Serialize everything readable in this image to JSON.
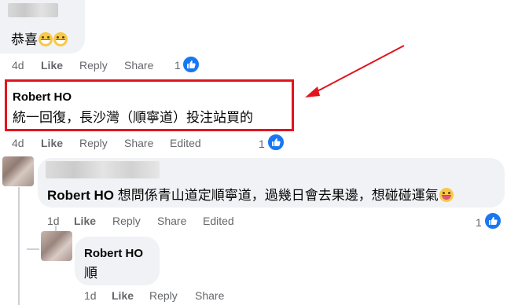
{
  "comment1": {
    "text": "恭喜",
    "emoji_count": 2,
    "meta": {
      "time": "4d",
      "like": "Like",
      "reply": "Reply",
      "share": "Share",
      "reactions": "1"
    }
  },
  "comment2": {
    "author": "Robert HO",
    "text": "統一回復，長沙灣（順寧道）投注站買的",
    "meta": {
      "time": "4d",
      "like": "Like",
      "reply": "Reply",
      "share": "Share",
      "edited": "Edited",
      "reactions": "1"
    }
  },
  "comment3": {
    "author": "Robert HO",
    "text": "想問係青山道定順寧道，過幾日會去果邊，想碰碰運氣",
    "meta": {
      "time": "1d",
      "like": "Like",
      "reply": "Reply",
      "share": "Share",
      "edited": "Edited",
      "reactions": "1"
    }
  },
  "comment4": {
    "author": "Robert HO",
    "text": "順",
    "meta": {
      "time": "1d",
      "like": "Like",
      "reply": "Reply",
      "share": "Share"
    }
  },
  "colors": {
    "bubble": "#f0f2f5",
    "meta_text": "#65676b",
    "like_blue": "#1877f2",
    "annotation_red": "#e0151d"
  },
  "icons": [
    "like-thumb-icon",
    "grinning-emoji-icon",
    "tongue-emoji-icon",
    "annotation-arrow-icon"
  ]
}
